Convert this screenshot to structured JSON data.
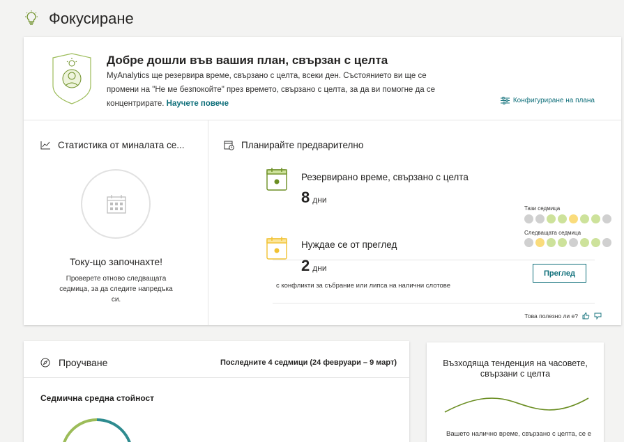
{
  "page": {
    "title": "Фокусиране",
    "icon": "lightbulb-icon"
  },
  "welcome": {
    "heading": "Добре дошли във вашия план, свързан с целта",
    "body": "MyAnalytics ще резервира време, свързано с целта, всеки ден. Състоянието ви ще се промени на \"Не ме безпокойте\" през времето, свързано с целта, за да ви помогне да се концентрирате.",
    "learn_more": "Научете повече",
    "configure": "Конфигуриране на плана",
    "badge_icon": "focused-person-badge-icon",
    "configure_icon": "sliders-icon"
  },
  "stats": {
    "title": "Статистика от миналата се...",
    "title_icon": "trend-chart-icon",
    "placeholder_icon": "calendar-icon",
    "started": "Току-що започнахте!",
    "hint": "Проверете отново следващата седмица, за да следите напредъка си."
  },
  "plan": {
    "title": "Планирайте предварително",
    "title_icon": "calendar-clock-icon",
    "reserved": {
      "label": "Резервирано време, свързано с целта",
      "count": "8",
      "unit": "дни",
      "icon": "calendar-green-icon",
      "this_week_label": "Тази седмица",
      "next_week_label": "Следващата седмица",
      "this_week_dots": [
        "#d0d0d0",
        "#d0d0d0",
        "#cde29b",
        "#cde29b",
        "#fadc7c",
        "#cde29b",
        "#cde29b",
        "#d0d0d0"
      ],
      "next_week_dots": [
        "#d0d0d0",
        "#fadc7c",
        "#cde29b",
        "#cde29b",
        "#d0d0d0",
        "#cde29b",
        "#cde29b",
        "#d0d0d0"
      ]
    },
    "review": {
      "label": "Нуждае се от преглед",
      "count": "2",
      "unit": "дни",
      "icon": "calendar-yellow-icon",
      "button": "Преглед",
      "conflicts": "с конфликти за събрание или липса на налични слотове"
    },
    "feedback": {
      "question": "Това полезно ли е?",
      "up_icon": "thumbs-up-icon",
      "down_icon": "thumbs-down-icon"
    }
  },
  "learning": {
    "title": "Проучване",
    "title_icon": "compass-icon",
    "range": "Последните 4 седмици (24 февруари – 9 март)",
    "weekly_average": "Седмична средна стойност"
  },
  "trend": {
    "title": "Възходяща тенденция на часовете, свързани с целта",
    "note": "Вашето налично време, свързано с целта, се е"
  },
  "colors": {
    "accent": "#0f6f7a",
    "green": "#6b8e23",
    "yellow": "#f1c232",
    "gray_dot": "#d0d0d0"
  }
}
